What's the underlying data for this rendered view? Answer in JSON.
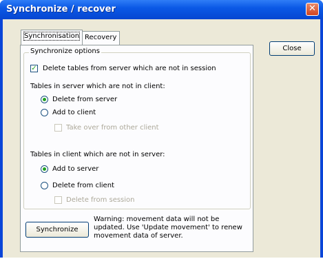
{
  "window": {
    "title": "Synchronize / recover",
    "close_glyph": "✕"
  },
  "tabs": [
    {
      "label": "Synchronisation",
      "active": true
    },
    {
      "label": "Recovery",
      "active": false
    }
  ],
  "close_button_label": "Close",
  "group": {
    "legend": "Synchronize options",
    "delete_tables_checkbox": {
      "label": "Delete tables from server which are not in session",
      "checked": true
    },
    "server_not_in_client": {
      "heading": "Tables in server which are not in client:",
      "options": [
        {
          "label": "Delete from server",
          "selected": true
        },
        {
          "label": "Add to client",
          "selected": false
        }
      ],
      "takeover_checkbox": {
        "label": "Take over from other client",
        "checked": false,
        "enabled": false
      }
    },
    "client_not_in_server": {
      "heading": "Tables in client which are not in server:",
      "options": [
        {
          "label": "Add to server",
          "selected": true
        },
        {
          "label": "Delete from client",
          "selected": false
        }
      ],
      "delete_from_session_checkbox": {
        "label": "Delete from session",
        "checked": false,
        "enabled": false
      }
    }
  },
  "synchronize_button_label": "Synchronize",
  "warning_text": "Warning: movement data will not be updated. Use 'Update movement' to renew movement data of server.",
  "colors": {
    "accent": "#21a121",
    "titlebar": "#0b59e6",
    "face": "#ece9d8"
  }
}
